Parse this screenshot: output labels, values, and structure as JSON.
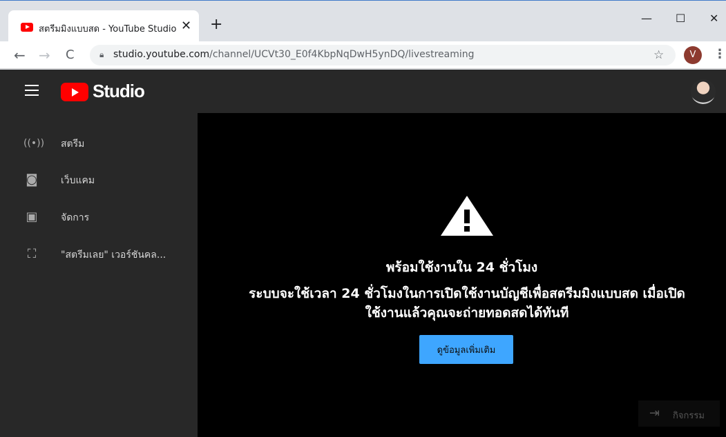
{
  "browser": {
    "tab_title": "สตรีมมิงแบบสด - YouTube Studio",
    "tab_close": "✕",
    "new_tab": "+",
    "window_controls": {
      "minimize": "—",
      "maximize": "☐",
      "close": "✕"
    },
    "nav": {
      "back": "←",
      "forward": "→",
      "reload": "C"
    },
    "url_host": "studio.youtube.com",
    "url_path": "/channel/UCVt30_E0f4KbpNqDwH5ynDQ/livestreaming",
    "profile_initial": "V",
    "star": "☆",
    "menu": "⋮"
  },
  "app": {
    "logo_text": "Studio",
    "sidebar": {
      "items": [
        {
          "label": "สตรีม",
          "icon": "broadcast-icon",
          "glyph": "((•))"
        },
        {
          "label": "เว็บแคม",
          "icon": "camera-icon",
          "glyph": "◙"
        },
        {
          "label": "จัดการ",
          "icon": "calendar-icon",
          "glyph": "▣"
        },
        {
          "label": "\"สตรีมเลย\" เวอร์ชันคล...",
          "icon": "classic-icon",
          "glyph": "⛶"
        }
      ]
    },
    "main": {
      "headline": "พร้อมใช้งานใน 24 ชั่วโมง",
      "body": "ระบบจะใช้เวลา 24 ชั่วโมงในการเปิดใช้งานบัญชีเพื่อสตรีมมิงแบบสด เมื่อเปิดใช้งานแล้วคุณจะถ่ายทอดสดได้ทันที",
      "button_label": "ดูข้อมูลเพิ่มเติม",
      "activity_label": "กิจกรรม",
      "activity_icon": "⇥"
    }
  },
  "colors": {
    "brand_red": "#ff0000",
    "accent_blue": "#3ea6ff",
    "sidebar_bg": "#282828",
    "main_bg": "#000000"
  }
}
